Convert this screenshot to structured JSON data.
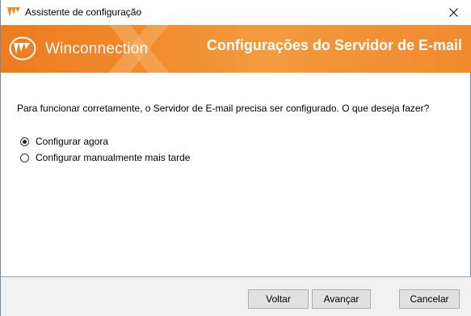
{
  "window": {
    "title": "Assistente de configuração"
  },
  "banner": {
    "logo_text": "Winconnection",
    "title": "Configurações do Servidor de E-mail",
    "colors": {
      "background": "#f08a2c",
      "text": "#ffffff"
    }
  },
  "content": {
    "question": "Para funcionar corretamente, o Servidor de E-mail precisa ser configurado. O que deseja fazer?",
    "options": [
      {
        "label": "Configurar agora",
        "selected": true
      },
      {
        "label": "Configurar manualmente mais tarde",
        "selected": false
      }
    ]
  },
  "footer": {
    "back_label": "Voltar",
    "next_label": "Avançar",
    "cancel_label": "Cancelar"
  },
  "icons": {
    "app": "winconnection-app-icon",
    "close": "close-icon",
    "logo": "winconnection-logo-icon"
  }
}
